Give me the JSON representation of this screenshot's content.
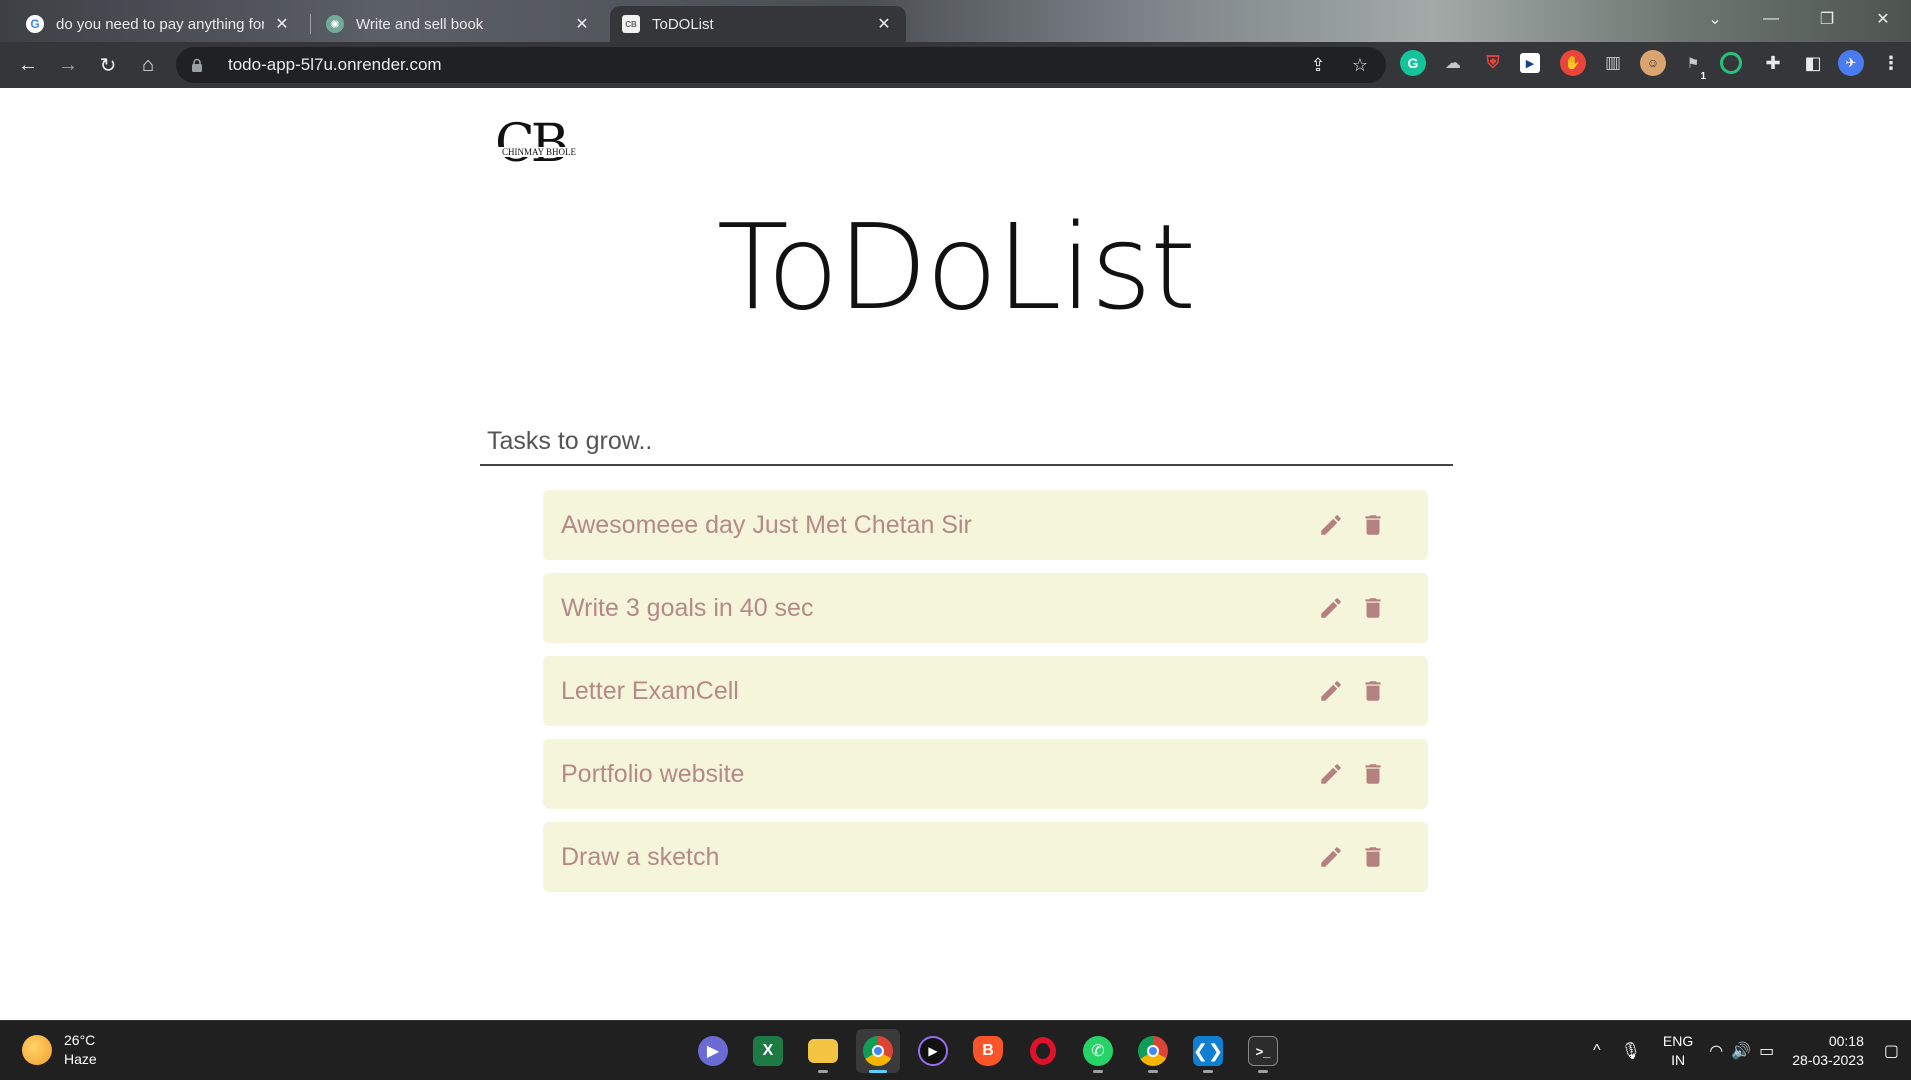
{
  "browser": {
    "tabs": [
      {
        "title": "do you need to pay anything for",
        "favicon": "google-icon",
        "active": false
      },
      {
        "title": "Write and sell book",
        "favicon": "chatgpt-icon",
        "active": false
      },
      {
        "title": "ToDOList",
        "favicon": "page-icon",
        "active": true
      }
    ],
    "url": "todo-app-5l7u.onrender.com",
    "extensions": [
      "grammarly-icon",
      "cloud-extension-icon",
      "shield-extension-icon",
      "video-extension-icon",
      "stop-hand-extension-icon",
      "reader-extension-icon",
      "face-extension-icon",
      "tag-extension-icon",
      "circle-extension-icon",
      "puzzle-icon",
      "sidebar-icon",
      "profile-avatar"
    ],
    "extension_badge": "1"
  },
  "page": {
    "logo_letters": "CB",
    "logo_name": "CHINMAY BHOLE",
    "heading": "ToDoList",
    "input_placeholder": "Tasks to grow..",
    "tasks": [
      {
        "text": "Awesomeee day Just Met Chetan Sir"
      },
      {
        "text": "Write 3 goals in 40 sec"
      },
      {
        "text": "Letter ExamCell"
      },
      {
        "text": "Portfolio website"
      },
      {
        "text": "Draw a sketch"
      }
    ],
    "colors": {
      "task_bg": "#f5f5dc",
      "task_text": "#b58a86",
      "icon": "#b58080"
    }
  },
  "taskbar": {
    "temperature": "26°C",
    "condition": "Haze",
    "language": "ENG",
    "region": "IN",
    "time": "00:18",
    "date": "28-03-2023",
    "apps": [
      "start-icon",
      "teams-chat-icon",
      "excel-icon",
      "file-explorer-icon",
      "chrome-icon",
      "media-player-icon",
      "brave-icon",
      "opera-icon",
      "whatsapp-icon",
      "chrome-profile-icon",
      "vscode-icon",
      "terminal-icon"
    ]
  }
}
